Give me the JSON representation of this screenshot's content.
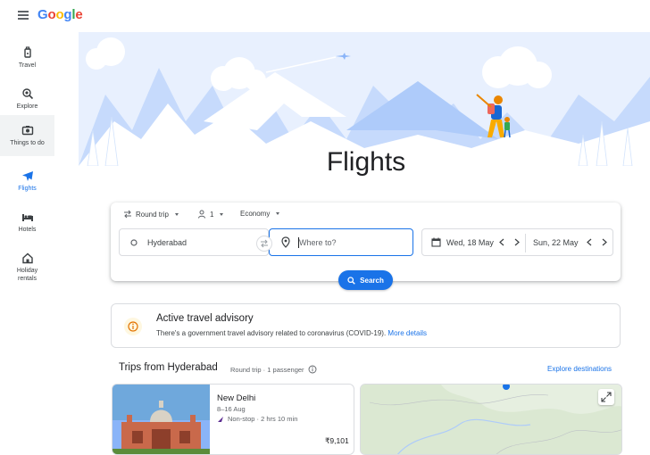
{
  "header": {
    "logo_letters": [
      "G",
      "o",
      "o",
      "g",
      "l",
      "e"
    ],
    "logo_colors": [
      "#4285f4",
      "#ea4335",
      "#fbbc05",
      "#4285f4",
      "#34a853",
      "#ea4335"
    ]
  },
  "sidebar": {
    "items": [
      {
        "label": "Travel",
        "icon": "suitcase-icon"
      },
      {
        "label": "Explore",
        "icon": "explore-icon"
      },
      {
        "label": "Things to do",
        "icon": "camera-icon"
      },
      {
        "label": "Flights",
        "icon": "plane-icon"
      },
      {
        "label": "Hotels",
        "icon": "bed-icon"
      },
      {
        "label": "Holiday",
        "label2": "rentals",
        "icon": "house-icon"
      }
    ]
  },
  "main": {
    "title": "Flights"
  },
  "search": {
    "trip_type": "Round trip",
    "passengers": "1",
    "cabin": "Economy",
    "origin": "Hyderabad",
    "destination_placeholder": "Where to?",
    "depart": "Wed, 18 May",
    "return": "Sun, 22 May",
    "button": "Search"
  },
  "advisory": {
    "title": "Active travel advisory",
    "body": "There's a government travel advisory related to coronavirus (COVID-19).",
    "link": "More details"
  },
  "trips": {
    "title": "Trips from Hyderabad",
    "subtitle": "Round trip · 1 passenger",
    "explore_link": "Explore destinations",
    "cards": [
      {
        "destination": "New Delhi",
        "dates": "8–16 Aug",
        "stops": "Non-stop · 2 hrs 10 min",
        "price": "₹9,101"
      }
    ]
  },
  "colors": {
    "accent": "#1a73e8",
    "advisory_icon": "#e37400"
  }
}
